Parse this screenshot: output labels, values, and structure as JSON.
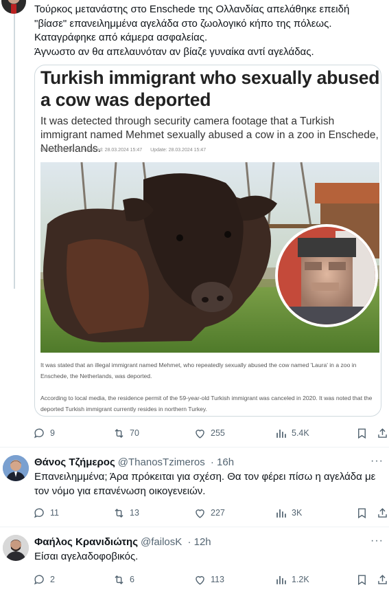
{
  "tweet": {
    "lines": [
      "Τούρκος μετανάστης στο Enschede της Ολλανδίας απελάθηκε επειδή",
      "\"βίασε\" επανειλημμένα αγελάδα στο ζωολογικό κήπο της πόλεως.",
      "Καταγράφηκε από κάμερα ασφαλείας.",
      "Άγνωστο αν θα απελαυνόταν αν βίαζε γυναίκα αντί αγελάδας."
    ],
    "card": {
      "headline": "Turkish immigrant who sexually abused a cow was deported",
      "subheadline": "It was detected through security camera footage that a Turkish immigrant named Mehmet sexually abused a cow in a zoo in Enschede, Netherlands.",
      "author": "Hamza Özçelik",
      "published": "Published: 28.03.2024 15:47",
      "updated": "Update: 28.03.2024 15:47",
      "caption1": "It was stated that an illegal immigrant named Mehmet, who repeatedly sexually abused the cow named 'Laura' in a zoo in Enschede, the Netherlands, was deported.",
      "caption2": "According to local media, the residence permit of the 59-year-old Turkish immigrant was canceled in 2020. It was noted that the deported Turkish immigrant currently resides in northern Turkey."
    },
    "stats": {
      "replies": "9",
      "reposts": "70",
      "likes": "255",
      "views": "5.4K"
    }
  },
  "replies": [
    {
      "name": "Θάνος Τζήμερος",
      "handle": "@ThanosTzimeros",
      "time": "· 16h",
      "lines": [
        "Επανειλημμένα; Άρα πρόκειται για σχέση. Θα τον φέρει πίσω η αγελάδα με",
        "τον νόμο για επανένωση οικογενειών."
      ],
      "stats": {
        "replies": "11",
        "reposts": "13",
        "likes": "227",
        "views": "3K"
      }
    },
    {
      "name": "Φαήλος Κρανιδιώτης",
      "handle": "@failosK",
      "time": "· 12h",
      "lines": [
        "Είσαι αγελαδοφοβικός."
      ],
      "stats": {
        "replies": "2",
        "reposts": "6",
        "likes": "113",
        "views": "1.2K"
      }
    }
  ],
  "more_label": "···",
  "icons": [
    "reply-icon",
    "repost-icon",
    "like-icon",
    "views-icon",
    "bookmark-icon",
    "share-icon"
  ],
  "colors": {
    "text": "#0f1419",
    "secondary": "#536471",
    "border": "#cfd9de"
  }
}
